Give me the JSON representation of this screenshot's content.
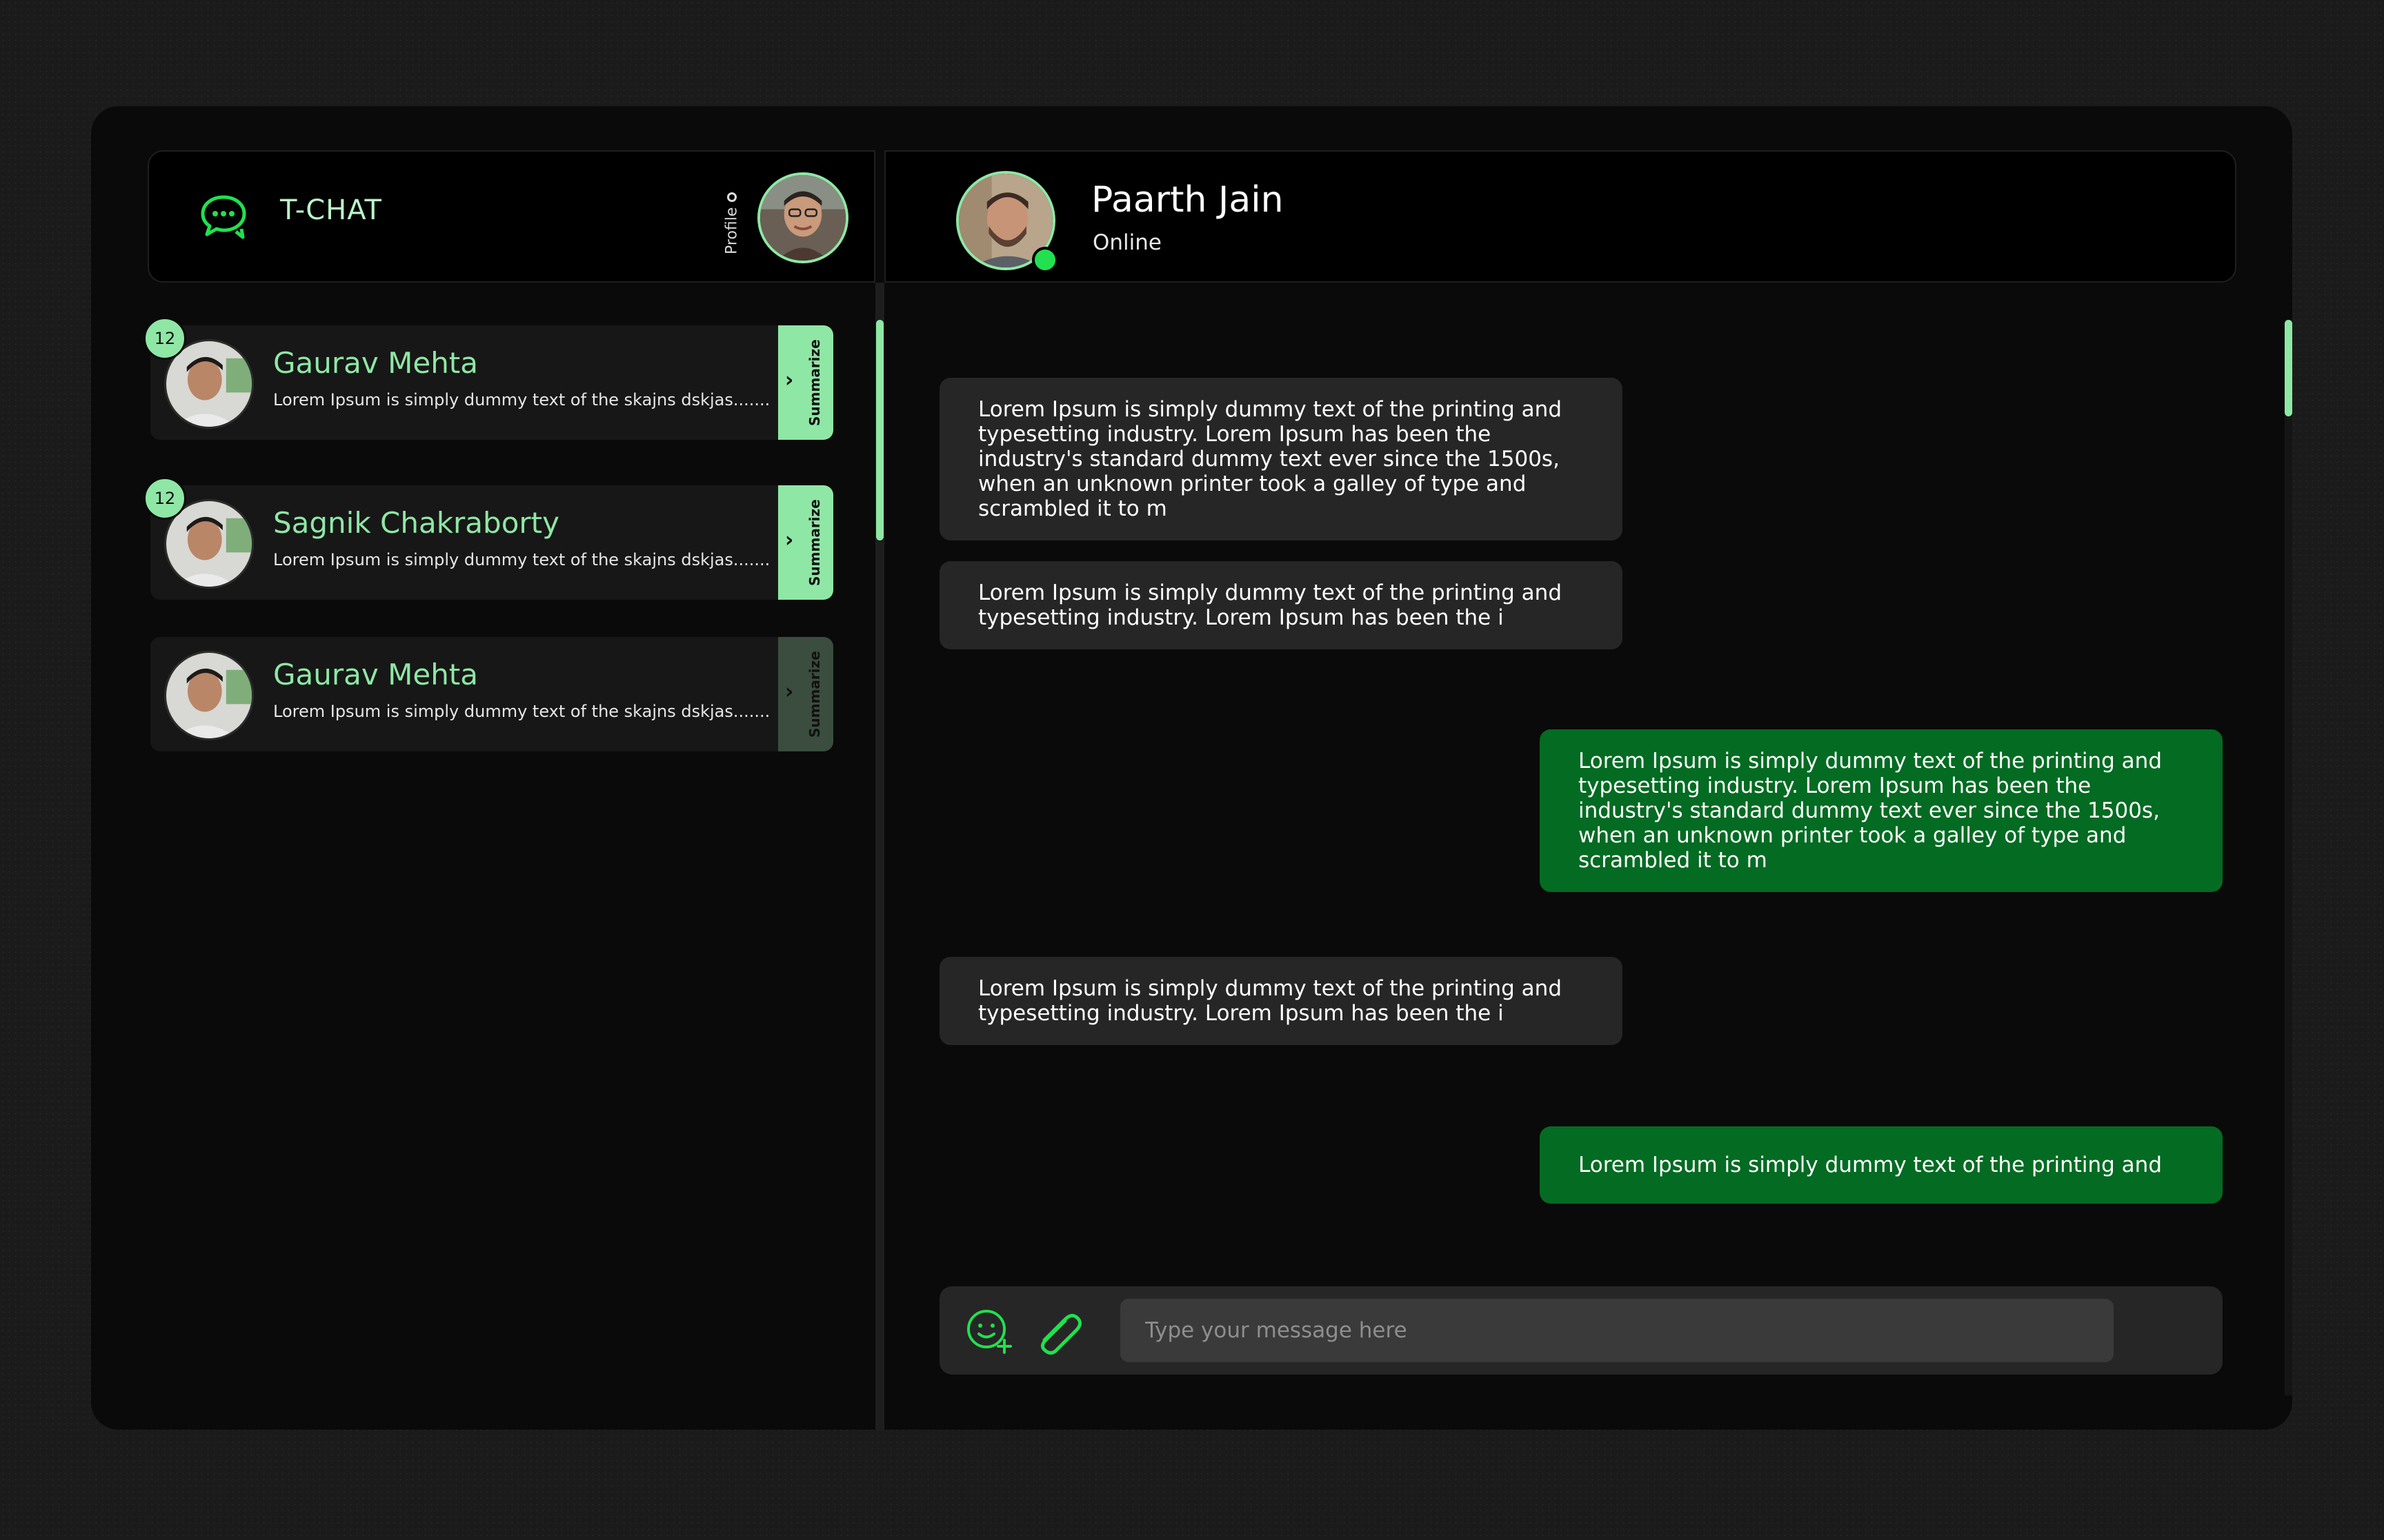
{
  "app": {
    "title": "T-CHAT",
    "profile_label": "Profile"
  },
  "contact": {
    "name": "Paarth Jain",
    "status": "Online"
  },
  "sidebar": {
    "items": [
      {
        "name": "Gaurav Mehta",
        "preview": "Lorem Ipsum is simply dummy text of the skajns dskjas.......",
        "badge": "12",
        "summarize": "Summarize"
      },
      {
        "name": "Sagnik Chakraborty",
        "preview": "Lorem Ipsum is simply dummy text of the skajns dskjas.......",
        "badge": "12",
        "summarize": "Summarize"
      },
      {
        "name": "Gaurav Mehta",
        "preview": "Lorem Ipsum is simply dummy text of the skajns dskjas.......",
        "badge": "",
        "summarize": "Summarize"
      }
    ]
  },
  "messages": [
    {
      "direction": "in",
      "text": "Lorem Ipsum is simply dummy text of the printing and typesetting industry. Lorem Ipsum has been the industry's standard dummy text ever since the 1500s, when an unknown printer took a galley of type and scrambled it to m"
    },
    {
      "direction": "in",
      "text": "Lorem Ipsum is simply dummy text of the printing and typesetting industry. Lorem Ipsum has been the i"
    },
    {
      "direction": "out",
      "text": "Lorem Ipsum is simply dummy text of the printing and typesetting industry. Lorem Ipsum has been the industry's standard dummy text ever since the 1500s, when an unknown printer took a galley of type and scrambled it to m"
    },
    {
      "direction": "in",
      "text": "Lorem Ipsum is simply dummy text of the printing and typesetting industry. Lorem Ipsum has been the i"
    },
    {
      "direction": "out",
      "text": "Lorem Ipsum is simply dummy text of the printing and"
    }
  ],
  "composer": {
    "placeholder": "Type your message here"
  },
  "colors": {
    "accent": "#8ee7a4",
    "bright_green": "#22e04f",
    "outgoing_bubble": "#036b22",
    "incoming_bubble": "#262626"
  }
}
